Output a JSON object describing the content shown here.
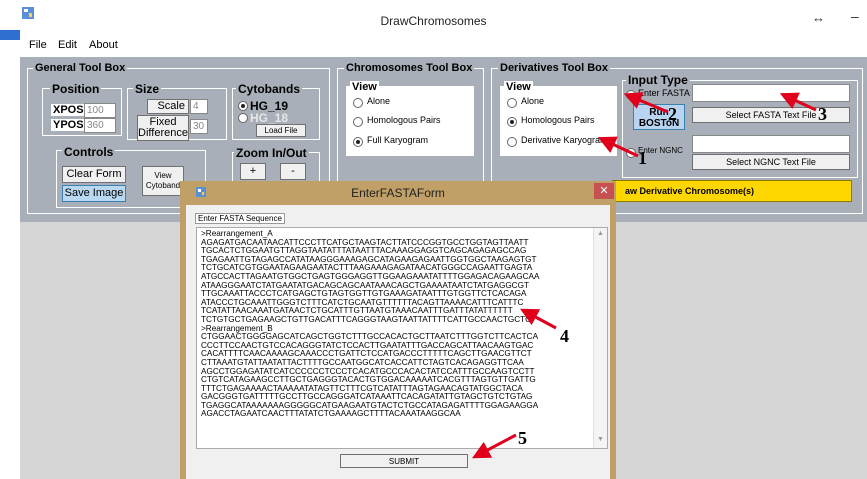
{
  "window": {
    "title": "DrawChromosomes",
    "resize_glyph": "↔",
    "minimize_glyph": "–",
    "icon": "app-icon"
  },
  "menu": [
    "File",
    "Edit",
    "About"
  ],
  "general_toolbox": {
    "title": "General Tool Box",
    "position": {
      "title": "Position",
      "xpos_label": "XPOS",
      "xpos_value": "100",
      "ypos_label": "YPOS",
      "ypos_value": "360"
    },
    "size": {
      "title": "Size",
      "scale_label": "Scale",
      "scale_value": "4",
      "fixed_label_1": "Fixed",
      "fixed_label_2": "Difference",
      "fixed_value": "30"
    },
    "cytobands": {
      "title": "Cytobands",
      "hg19": "HG_19",
      "hg18": "HG_18",
      "load_file": "Load File"
    },
    "controls": {
      "title": "Controls",
      "clear_form": "Clear Form",
      "save_image": "Save Image",
      "view_cytoband_1": "View",
      "view_cytoband_2": "Cytoband"
    },
    "zoom": {
      "title": "Zoom In/Out",
      "plus": "+",
      "minus": "-"
    }
  },
  "chromosomes_toolbox": {
    "title": "Chromosomes Tool Box",
    "view_title": "View",
    "options": [
      "Alone",
      "Homologous Pairs",
      "Full Karyogram"
    ],
    "selected_index": 2
  },
  "derivatives_toolbox": {
    "title": "Derivatives Tool Box",
    "view_title": "View",
    "options": [
      "Alone",
      "Homologous Pairs",
      "Derivative Karyogram"
    ],
    "selected_index": 1,
    "input_type": {
      "title": "Input Type",
      "enter_fasta": "Enter FASTA",
      "enter_ngnc": "Enter NGNC",
      "select_fasta": "Select FASTA Text File",
      "select_ngnc": "Select NGNC Text File",
      "run_1": "Run",
      "run_2": "BOSToN"
    },
    "draw_button": "aw Derivative Chromosome(s)"
  },
  "dialog": {
    "title": "EnterFASTAForm",
    "close_glyph": "✕",
    "label": "Enter FASTA Sequence",
    "sequence": ">Rearrangement_A\nAGAGATGACAATAACATTCCCTTCATGCTAAGTACTTATCCCGGTGCCTGGTAGTTAATT\nTGCACTCTGGAATGTTAGGTAATATTTATAATTTACAAAGGAGGTCAGCAGAGAGCCAG\nTGAGAATTGTAGAGCCATATAAGGGAAAGAGCATAGAAGAGAATTGGTGGCTAAGAGTGT\nTCTGCATCGTGGAATAGAAGAATACTTTAAGAAAGAGATAACATGGGCCAGAATTGAGTA\nATGCCACTTAGAATGTGGCTGAGTGGGAGGTTGGAAGAAATATTTTGGAGACAGAAGCAA\nATAAGGGAATCTATGAATATGACAGCAGCAATAAACAGCTGAAAATAATCTATGAGGCGT\nTTGCAAATTACCCTCATGAGCTGTAGTGGTTGTGAAAGATAATTTGTGGTTCTCACAGA\nATACCCTGCAAATTGGGTCTTTCATCTGCAATGTTTTTTACAGTTAAAACATTTCATTTC\nTCATATTAACAAATGATAACTCTGCATTTGTTAATGTAAACAATTTGATTTATATTTTTT\nTCTGTGCTGAGAAGCTGTTGACATTTCAGGGTAAGTAATTATTTTCATTGCCAACTGCTG\n>Rearrangement_B\nCTGGAACTGGGGAGCATCAGCTGGTCTTTGCCACACTGCTTAATCTTTGGTCTTCACTCA\nCCCTTCCAACTGTCCACAGGGTATCTCCACTTGAATATTTGACCAGCATTAACAAGTGAC\nCACATTTTCAACAAAAGCAAACCCTGATTCTCCATGACCCTTTTTCAGCTTGAACGTTCT\nCTTAAATGTATTAATATTACTTTTGCCAATGGCATCACCATTCTAGTCACAGAGGTTCAA\nAGCCTGGAGATATCATCCCCCCTCCCTCACATGCCCACACTATCCATTTGCCAAGTCCTT\nCTGTCATAGAAGCCTTGCTGAGGGTACACTGTGGACAAAAATCACGTTTAGTGTTGATTG\nTTTCTGAGAAAACTAAAAATATAGTTCTTTCGTCATATTTAGTAGAACAGTATGGCTACA\nGACGGGTGATTTTTGCCTTGCCAGGGATCATAAATTCACAGATATTGTAGCTGTCTGTAG\nTGAGGCATAAAAAAAGGGGGCATGAAGAATGTACTCTGCCATAGAGATTTTGGAGAAGGA\nAGACCTAGAATCAACTTTATATCTGAAAAGCTTTTACAAATAAGGCAA",
    "submit": "SUBMIT"
  },
  "annotations": {
    "n1": "1",
    "n2": "2",
    "n3": "3",
    "n4": "4",
    "n5": "5",
    "arrow_color": "#e0001b"
  },
  "colors": {
    "toolbox_bg": "#a9afb8",
    "dialog_frame": "#c0a066",
    "run_button": "#b8d4f0",
    "draw_button": "#ffd700",
    "save_button": "#b9d8f2"
  }
}
